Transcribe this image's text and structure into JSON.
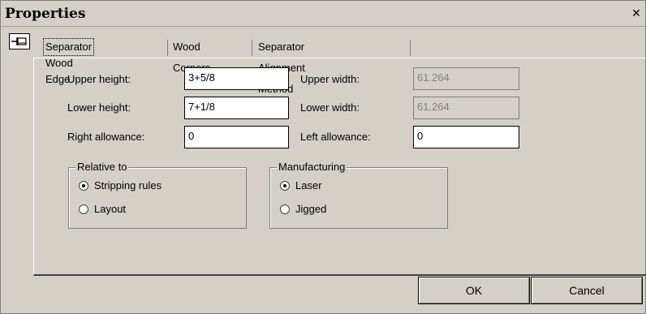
{
  "window": {
    "title": "Properties",
    "close_glyph": "✕"
  },
  "tabs": [
    {
      "label": "Separator Wood Edge",
      "active": true
    },
    {
      "label": "Wood Corners",
      "active": false
    },
    {
      "label": "Separator Alignment Method",
      "active": false
    }
  ],
  "fields": {
    "upper_height": {
      "label": "Upper height:",
      "value": "3+5/8"
    },
    "upper_width": {
      "label": "Upper width:",
      "value": "61.264"
    },
    "lower_height": {
      "label": "Lower height:",
      "value": "7+1/8"
    },
    "lower_width": {
      "label": "Lower width:",
      "value": "61.264"
    },
    "right_allowance": {
      "label": "Right allowance:",
      "value": "0"
    },
    "left_allowance": {
      "label": "Left allowance:",
      "value": "0"
    }
  },
  "relative_to": {
    "legend": "Relative to",
    "options": [
      {
        "label": "Stripping rules",
        "selected": true
      },
      {
        "label": "Layout",
        "selected": false
      }
    ]
  },
  "manufacturing": {
    "legend": "Manufacturing",
    "options": [
      {
        "label": "Laser",
        "selected": true
      },
      {
        "label": "Jigged",
        "selected": false
      }
    ]
  },
  "buttons": {
    "ok": "OK",
    "cancel": "Cancel"
  }
}
